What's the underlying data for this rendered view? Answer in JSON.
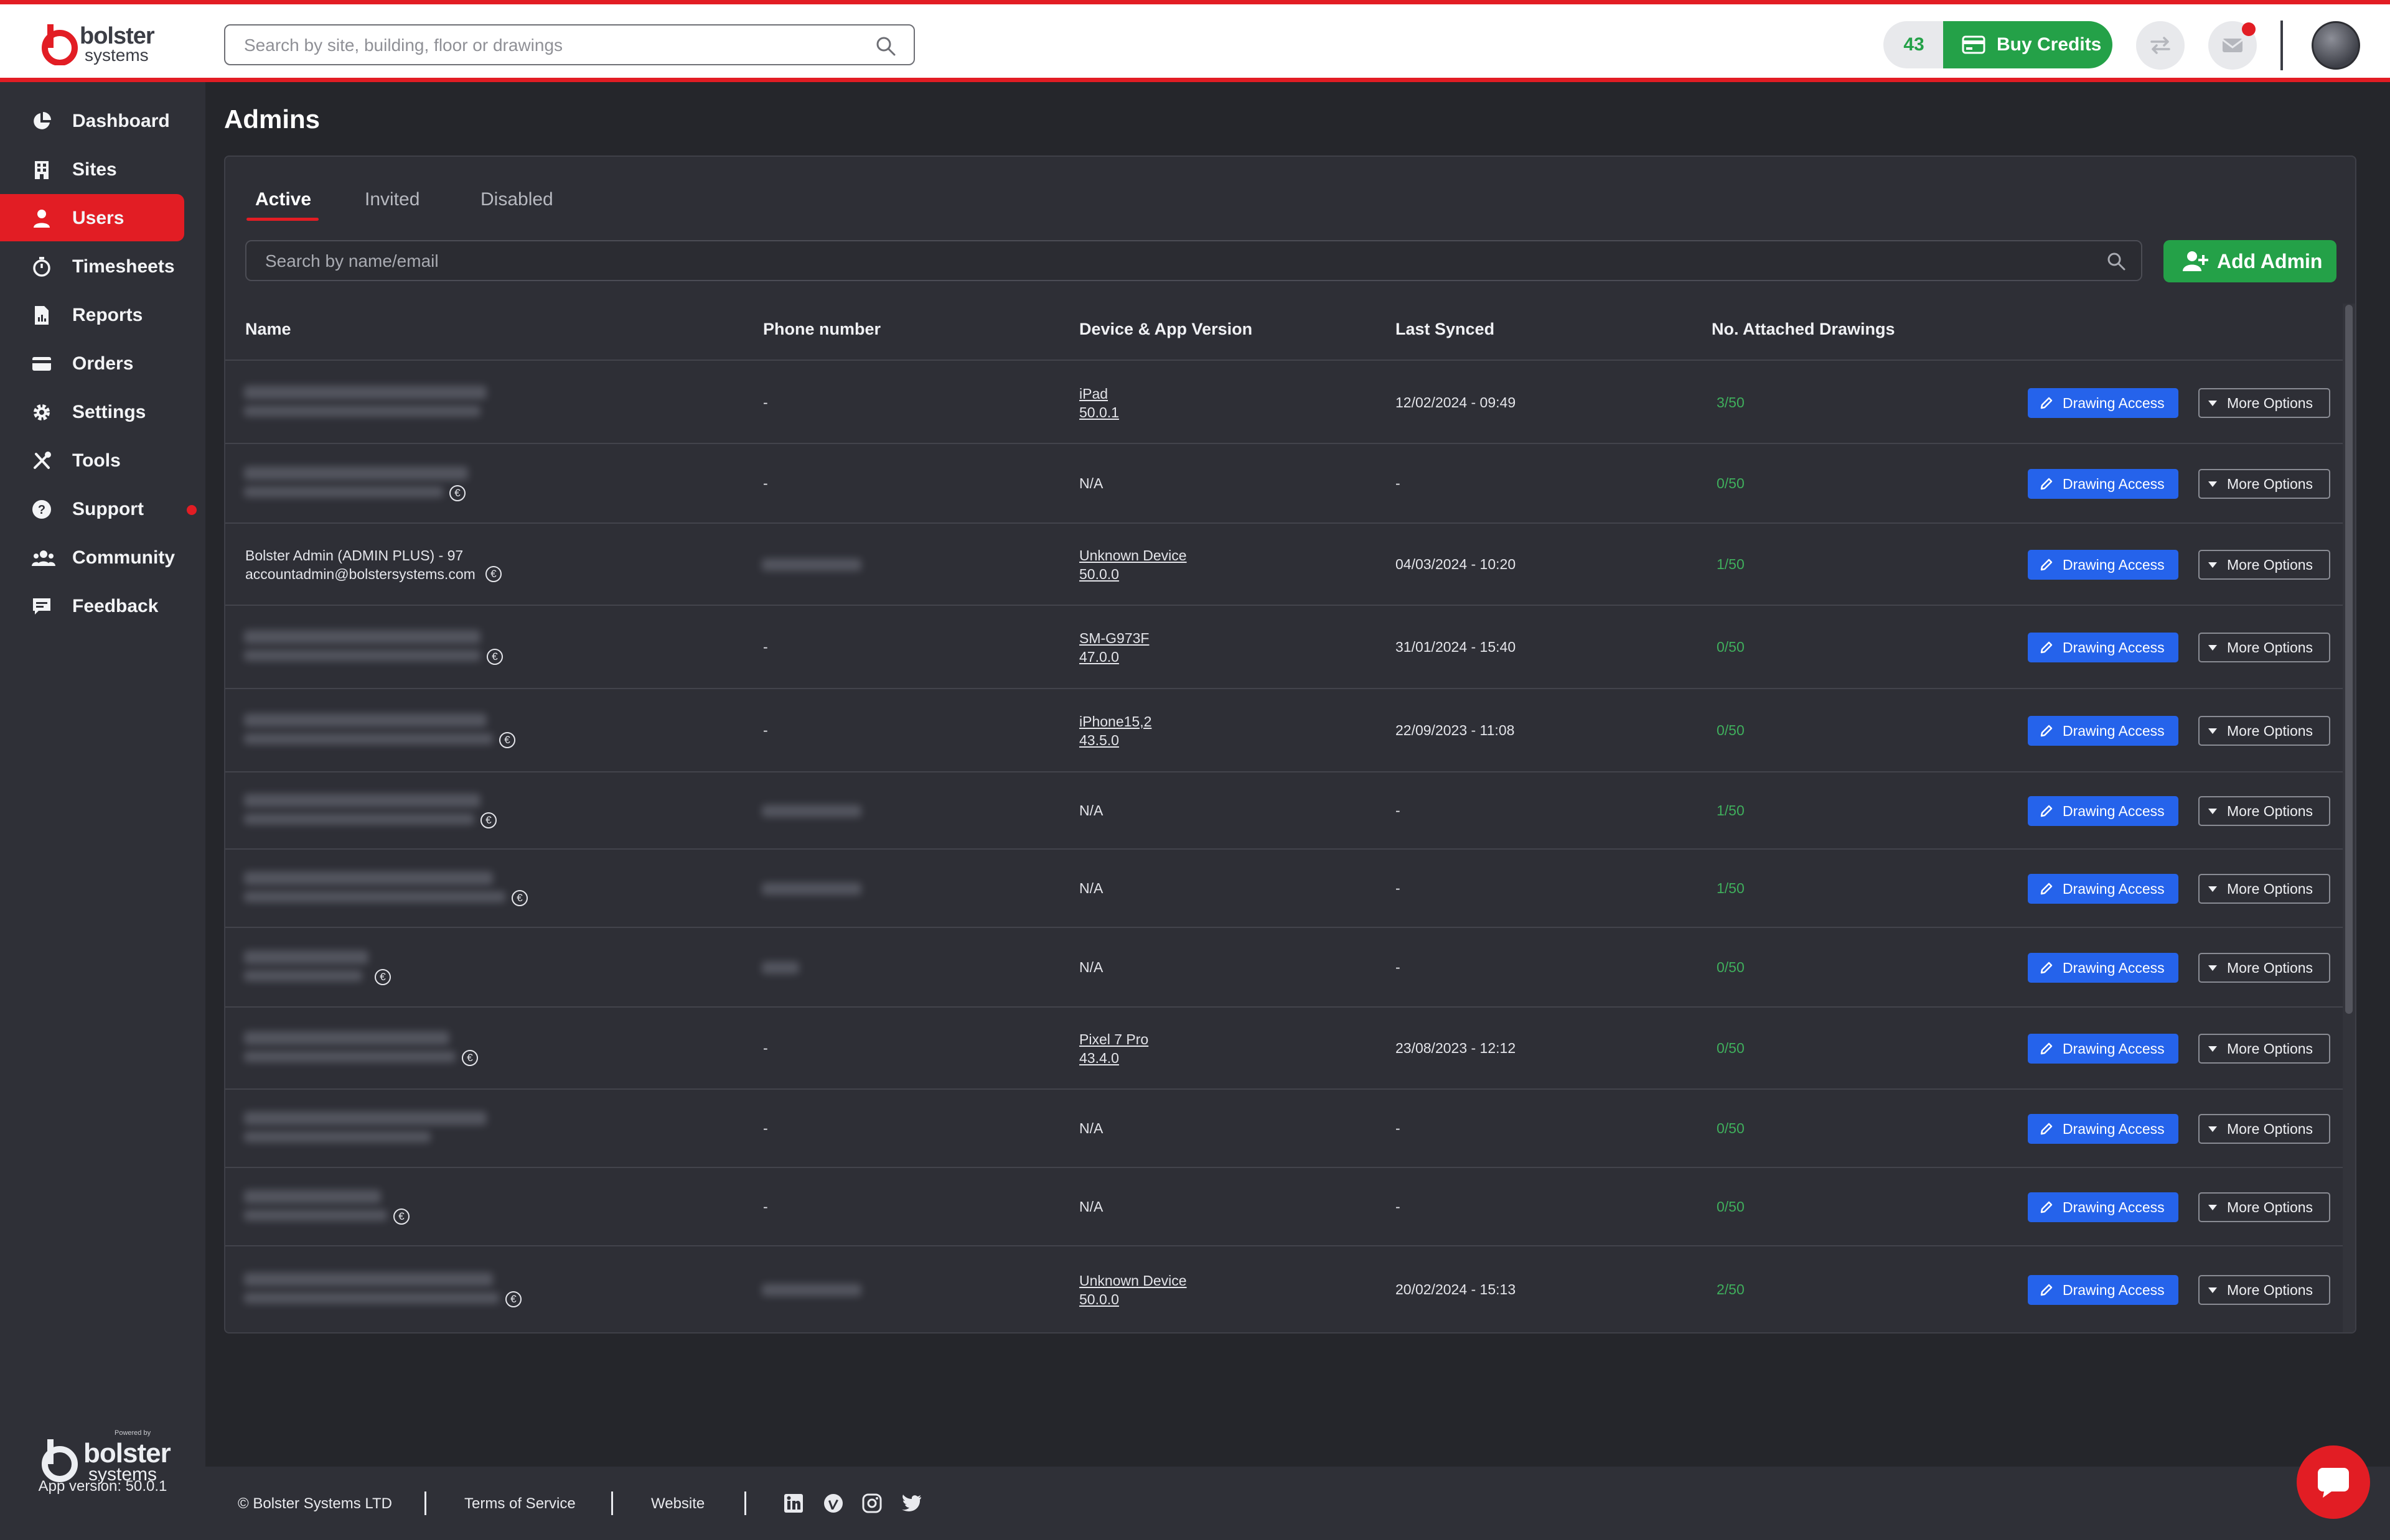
{
  "brand": {
    "name_line1": "bolster",
    "name_line2": "systems",
    "powered_by": "Powered by",
    "accent": "#e21d24",
    "green": "#24a148",
    "blue": "#2563eb"
  },
  "topbar": {
    "search_placeholder": "Search by site, building, floor or drawings",
    "credits_count": "43",
    "buy_credits": "Buy Credits"
  },
  "sidebar": {
    "items": [
      {
        "label": "Dashboard",
        "icon": "pie-chart-icon"
      },
      {
        "label": "Sites",
        "icon": "building-icon"
      },
      {
        "label": "Users",
        "icon": "user-icon",
        "active": true
      },
      {
        "label": "Timesheets",
        "icon": "stopwatch-icon"
      },
      {
        "label": "Reports",
        "icon": "report-icon"
      },
      {
        "label": "Orders",
        "icon": "card-icon"
      },
      {
        "label": "Settings",
        "icon": "gear-icon"
      },
      {
        "label": "Tools",
        "icon": "tools-icon"
      },
      {
        "label": "Support",
        "icon": "question-icon"
      },
      {
        "label": "Community",
        "icon": "users-icon"
      },
      {
        "label": "Feedback",
        "icon": "feedback-icon"
      }
    ],
    "app_version": "App version: 50.0.1"
  },
  "page": {
    "title": "Admins",
    "tabs": [
      "Active",
      "Invited",
      "Disabled"
    ],
    "search_placeholder": "Search by name/email",
    "add_admin": "Add Admin",
    "columns": [
      "Name",
      "Phone number",
      "Device & App Version",
      "Last Synced",
      "No. Attached Drawings"
    ],
    "drawing_access": "Drawing Access",
    "more_options": "More Options",
    "rows": [
      {
        "name": "",
        "email": "",
        "euro": false,
        "phone": "-",
        "device": "iPad",
        "version": "50.0.1",
        "synced": "12/02/2024 - 09:49",
        "drawings": "3/50"
      },
      {
        "name": "",
        "email": "",
        "euro": true,
        "phone": "-",
        "device": "N/A",
        "version": "",
        "synced": "-",
        "drawings": "0/50"
      },
      {
        "name": "Bolster Admin (ADMIN PLUS) - 97",
        "email": "accountadmin@bolstersystems.com",
        "euro": true,
        "phone": "",
        "device": "Unknown Device",
        "version": "50.0.0",
        "synced": "04/03/2024 - 10:20",
        "drawings": "1/50"
      },
      {
        "name": "",
        "email": "",
        "euro": true,
        "phone": "-",
        "device": "SM-G973F",
        "version": "47.0.0",
        "synced": "31/01/2024 - 15:40",
        "drawings": "0/50"
      },
      {
        "name": "",
        "email": "",
        "euro": true,
        "phone": "-",
        "device": "iPhone15,2",
        "version": "43.5.0",
        "synced": "22/09/2023 - 11:08",
        "drawings": "0/50"
      },
      {
        "name": "",
        "email": "",
        "euro": true,
        "phone": "",
        "device": "N/A",
        "version": "",
        "synced": "-",
        "drawings": "1/50"
      },
      {
        "name": "",
        "email": "",
        "euro": true,
        "phone": "",
        "device": "N/A",
        "version": "",
        "synced": "-",
        "drawings": "1/50"
      },
      {
        "name": "",
        "email": "",
        "euro": true,
        "phone": "",
        "device": "N/A",
        "version": "",
        "synced": "-",
        "drawings": "0/50"
      },
      {
        "name": "",
        "email": "",
        "euro": true,
        "phone": "-",
        "device": "Pixel 7 Pro",
        "version": "43.4.0",
        "synced": "23/08/2023 - 12:12",
        "drawings": "0/50"
      },
      {
        "name": "",
        "email": "",
        "euro": false,
        "phone": "-",
        "device": "N/A",
        "version": "",
        "synced": "-",
        "drawings": "0/50"
      },
      {
        "name": "",
        "email": "",
        "euro": true,
        "phone": "-",
        "device": "N/A",
        "version": "",
        "synced": "-",
        "drawings": "0/50"
      },
      {
        "name": "",
        "email": "",
        "euro": true,
        "phone": "",
        "device": "Unknown Device",
        "version": "50.0.0",
        "synced": "20/02/2024 - 15:13",
        "drawings": "2/50"
      }
    ]
  },
  "footer": {
    "copyright": "© Bolster Systems LTD",
    "terms": "Terms of Service",
    "website": "Website",
    "socials": [
      "linkedin-icon",
      "vimeo-icon",
      "instagram-icon",
      "twitter-icon"
    ]
  }
}
